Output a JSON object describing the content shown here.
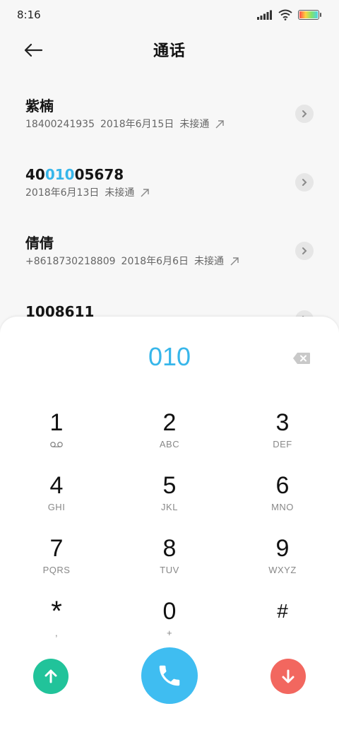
{
  "status_bar": {
    "time": "8:16"
  },
  "header": {
    "title": "通话"
  },
  "calls": [
    {
      "name": "紫楠",
      "number": "18400241935",
      "date": "2018年6月15日",
      "status": "未接通"
    },
    {
      "name_parts": [
        "40",
        "010",
        "05678"
      ],
      "date": "2018年6月13日",
      "status": "未接通"
    },
    {
      "name": "倩倩",
      "number": "+8618730218809",
      "date": "2018年6月6日",
      "status": "未接通"
    },
    {
      "name": "1008611"
    }
  ],
  "dialer": {
    "input": "010",
    "keys": [
      {
        "digit": "1",
        "sub": ""
      },
      {
        "digit": "2",
        "sub": "ABC"
      },
      {
        "digit": "3",
        "sub": "DEF"
      },
      {
        "digit": "4",
        "sub": "GHI"
      },
      {
        "digit": "5",
        "sub": "JKL"
      },
      {
        "digit": "6",
        "sub": "MNO"
      },
      {
        "digit": "7",
        "sub": "PQRS"
      },
      {
        "digit": "8",
        "sub": "TUV"
      },
      {
        "digit": "9",
        "sub": "WXYZ"
      },
      {
        "digit": "*",
        "sub": ","
      },
      {
        "digit": "0",
        "sub": "+"
      },
      {
        "digit": "#",
        "sub": ""
      }
    ]
  },
  "colors": {
    "accent": "#37b6ea",
    "call_button": "#3fbdf1",
    "up_button": "#21c39a",
    "down_button": "#f2675f"
  }
}
